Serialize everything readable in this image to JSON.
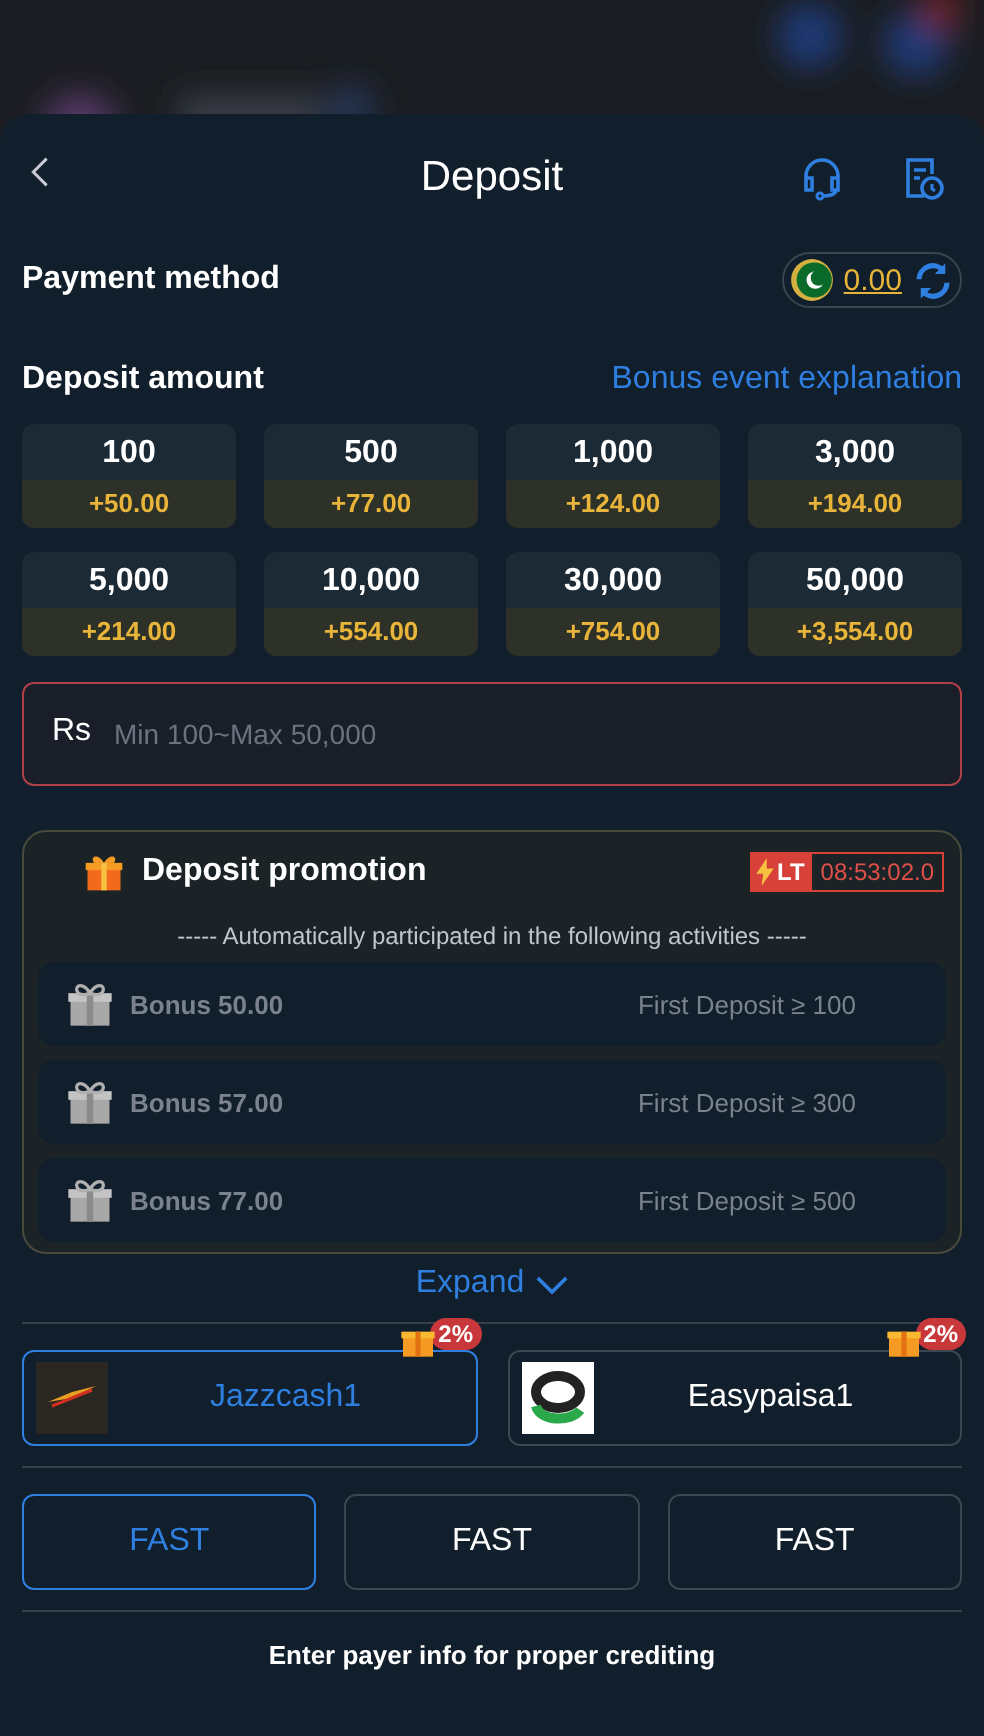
{
  "header": {
    "title": "Deposit"
  },
  "payment_method": {
    "label": "Payment method",
    "balance": "0.00"
  },
  "deposit_amount": {
    "label": "Deposit amount",
    "link": "Bonus event explanation"
  },
  "amounts": [
    {
      "amount": "100",
      "bonus": "+50.00"
    },
    {
      "amount": "500",
      "bonus": "+77.00"
    },
    {
      "amount": "1,000",
      "bonus": "+124.00"
    },
    {
      "amount": "3,000",
      "bonus": "+194.00"
    },
    {
      "amount": "5,000",
      "bonus": "+214.00"
    },
    {
      "amount": "10,000",
      "bonus": "+554.00"
    },
    {
      "amount": "30,000",
      "bonus": "+754.00"
    },
    {
      "amount": "50,000",
      "bonus": "+3,554.00"
    }
  ],
  "amount_field": {
    "currency": "Rs",
    "placeholder": "Min 100~Max 50,000"
  },
  "promotion": {
    "title": "Deposit promotion",
    "badge": "LT",
    "timer": "08:53:02.0",
    "subtitle": "----- Automatically participated in the following activities -----",
    "items": [
      {
        "bonus": "Bonus 50.00",
        "condition": "First Deposit ≥ 100"
      },
      {
        "bonus": "Bonus 57.00",
        "condition": "First Deposit ≥ 300"
      },
      {
        "bonus": "Bonus 77.00",
        "condition": "First Deposit ≥ 500"
      }
    ],
    "expand": "Expand"
  },
  "methods": [
    {
      "name": "Jazzcash1",
      "badge": "2%",
      "selected": true,
      "kind": "jazz"
    },
    {
      "name": "Easypaisa1",
      "badge": "2%",
      "selected": false,
      "kind": "easy"
    }
  ],
  "channels": [
    {
      "label": "FAST",
      "selected": true
    },
    {
      "label": "FAST",
      "selected": false
    },
    {
      "label": "FAST",
      "selected": false
    }
  ],
  "footer": "Enter payer info for proper crediting"
}
